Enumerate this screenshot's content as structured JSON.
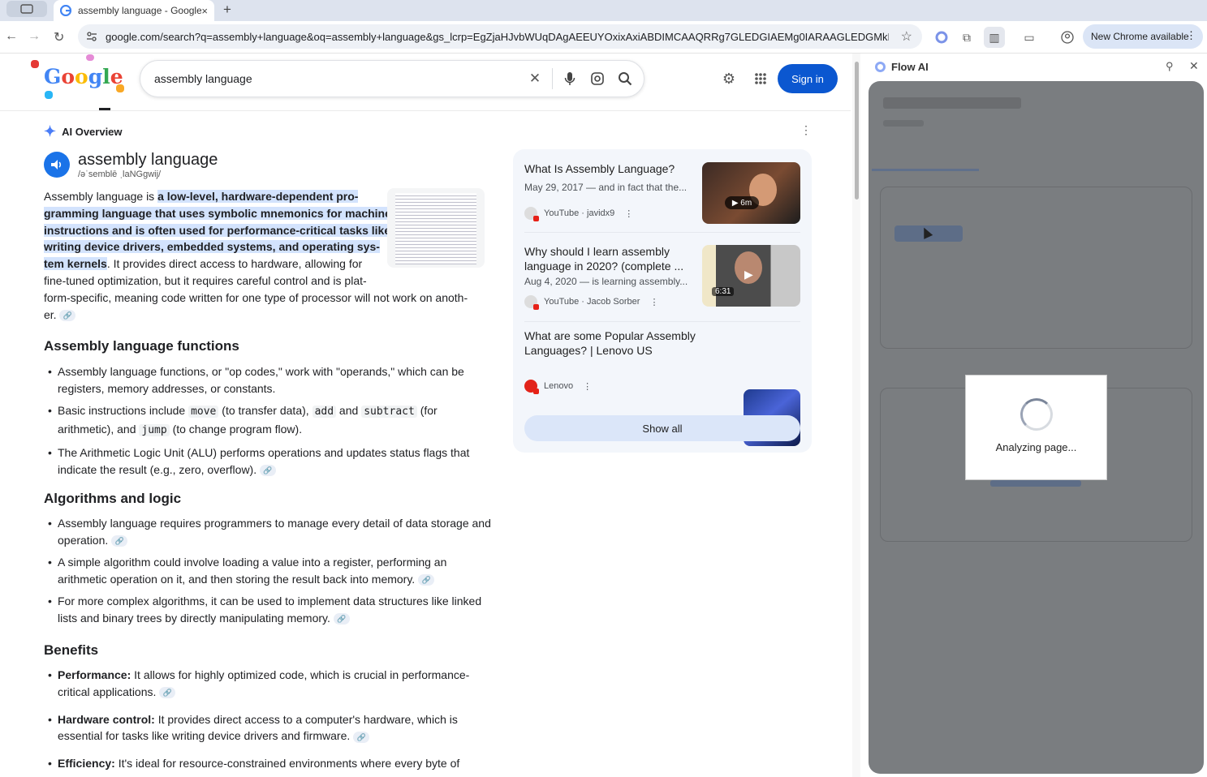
{
  "browser": {
    "tab_title": "assembly language - Google",
    "tab_close": "×",
    "new_tab": "+",
    "url": "google.com/search?q=assembly+language&oq=assembly+language&gs_lcrp=EgZjaHJvbWUqDAgAEEUYOxixAxiABDIMCAAQRRg7GLEDGIAEMg0IARAAGLEDGMkDGIAE...",
    "update_label": "New Chrome available",
    "menu": "⋮"
  },
  "google": {
    "logo_letters": [
      "G",
      "o",
      "o",
      "g",
      "l",
      "e"
    ],
    "query": "assembly language",
    "sign_in": "Sign in"
  },
  "ai_overview": {
    "heading": "AI Overview",
    "term": "assembly language",
    "pronunciation": "/əˈsemblē ˌlaNGgwij/",
    "summary_lines": [
      {
        "plain": "Assembly language is ",
        "hl": "a low-level, hardware-dependent pro-"
      },
      {
        "plain": "",
        "hl": "gramming language that uses symbolic mnemonics for machine"
      },
      {
        "plain": "",
        "hl": "instructions and is often used for performance-critical tasks like"
      },
      {
        "plain": "",
        "hl": "writing device drivers, embedded systems, and operating sys-"
      },
      {
        "plain": "",
        "hl": "tem kernels",
        "tail": ". It provides direct access to hardware, allowing for"
      },
      {
        "plain": "fine-tuned optimization, but it requires careful control and is plat-"
      },
      {
        "plain": "form-specific, meaning code written for one type of processor will not work on anoth-"
      },
      {
        "plain": "er."
      }
    ],
    "sections": [
      {
        "title": "Assembly language functions",
        "items": [
          "Assembly language functions, or \"op codes,\" work with \"operands,\" which can be registers, memory addresses, or constants.",
          "__basic__",
          "The Arithmetic Logic Unit (ALU) performs operations and updates status flags that indicate the result (e.g., zero, overflow)."
        ]
      },
      {
        "title": "Algorithms and logic",
        "items": [
          "Assembly language requires programmers to manage every detail of data storage and operation.",
          "A simple algorithm could involve loading a value into a register, performing an arithmetic operation on it, and then storing the result back into memory.",
          "For more complex algorithms, it can be used to implement data structures like linked lists and binary trees by directly manipulating memory."
        ]
      },
      {
        "title": "Benefits",
        "items": [
          {
            "bold": "Performance:",
            "text": " It allows for highly optimized code, which is crucial in performance-critical applications."
          },
          {
            "bold": "Hardware control:",
            "text": " It provides direct access to a computer's hardware, which is essential for tasks like writing device drivers and firmware."
          },
          {
            "bold": "Efficiency:",
            "text": " It's ideal for resource-constrained environments where every byte of"
          }
        ]
      }
    ],
    "basic_instr": {
      "pre": "Basic instructions include ",
      "c1": "move",
      "t1": " (to transfer data), ",
      "c2": "add",
      "t2": " and ",
      "c3": "subtract",
      "t3": " (for arithmetic), and ",
      "c4": "jump",
      "t4": " (to change program flow)."
    }
  },
  "videos": [
    {
      "title": "What Is Assembly Language?",
      "date": "May 29, 2017 — and in fact that the...",
      "source": "YouTube · javidx9",
      "duration": "6m"
    },
    {
      "title": "Why should I learn assembly language in 2020? (complete ...",
      "date": "Aug 4, 2020 — is learning assembly...",
      "source": "YouTube · Jacob Sorber",
      "duration": "6:31"
    },
    {
      "title": "What are some Popular Assembly Languages? | Lenovo US",
      "date": "",
      "source": "Lenovo",
      "duration": ""
    }
  ],
  "show_all": "Show all",
  "side_panel": {
    "title": "Flow AI",
    "modal_text": "Analyzing page..."
  }
}
